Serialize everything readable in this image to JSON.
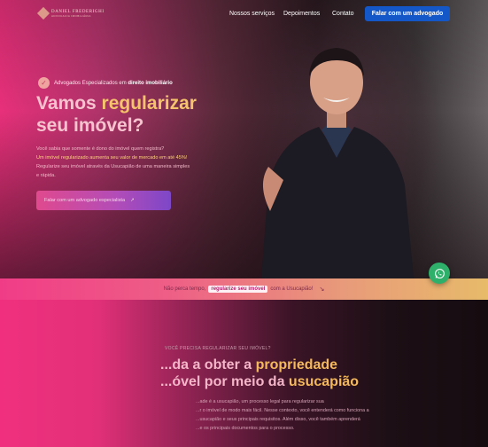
{
  "nav": {
    "logo_name": "DANIEL FREDERIGHI",
    "logo_tagline": "ADVOCACIA IMOBILIÁRIA",
    "links": [
      "Nossos serviços",
      "Depoimentos",
      "Contato"
    ],
    "cta_label": "Falar com um advogado"
  },
  "hero": {
    "badge_prefix": "Advogados Especializados em ",
    "badge_highlight": "direito imobiliário",
    "headline_part1": "Vamos ",
    "headline_highlight": "regularizar",
    "headline_part2": "seu imóvel?",
    "sub_line1": "Você sabia que somente é dono do imóvel quem registra?",
    "sub_line2": "Um imóvel regularizado aumenta seu valor de mercado em até 45%!",
    "sub_line3": "Regularize seu imóvel através da Usucapião de uma maneira simples",
    "sub_line4": "e rápida.",
    "cta_label": "Falar com um advogado especialista",
    "cta_arrow": "↗"
  },
  "banner": {
    "prefix": "Não perca tempo,",
    "highlight": "regularize seu imóvel",
    "suffix": "com a Usucapião!",
    "arrow": "↘"
  },
  "section": {
    "eyebrow": "VOCÊ PRECISA REGULARIZAR SEU IMÓVEL?",
    "title_line1_a": "...da a obter a ",
    "title_line1_b": "propriedade",
    "title_line2_a": "...óvel por meio da ",
    "title_line2_b": "usucapião",
    "para_line1": "...ade é a usucapião, um processo legal para regularizar sua",
    "para_line2": "...r o imóvel de modo mais fácil. Nesse contexto, você entenderá como funciona a",
    "para_line3": "...usucapião e seus principais requisitos. Além disso, você também aprenderá",
    "para_line4": "...e os principais documentos para o processo."
  },
  "colors": {
    "accent_pink": "#e8307a",
    "accent_gold": "#f5c36b",
    "nav_button": "#1457c9",
    "whatsapp": "#2fb06a"
  },
  "icons": [
    "logo-mark",
    "check-badge-icon",
    "arrow-up-right-icon",
    "whatsapp-icon",
    "arrow-down-right-icon"
  ]
}
